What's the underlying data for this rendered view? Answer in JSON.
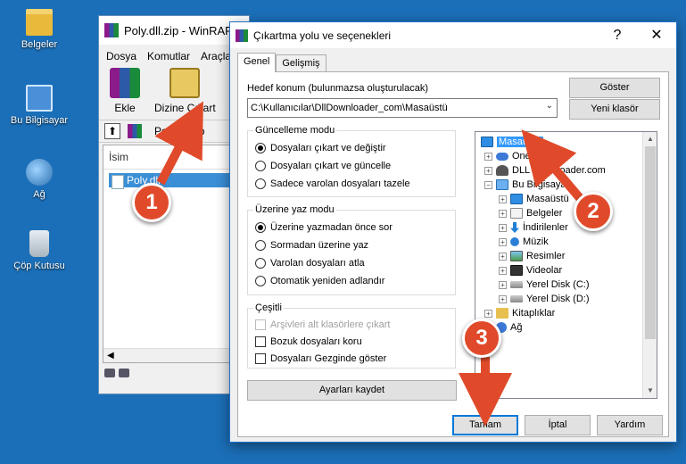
{
  "desktop": {
    "icons": [
      {
        "label": "Belgeler",
        "icon": "folder-icon"
      },
      {
        "label": "Bu Bilgisayar",
        "icon": "computer-icon"
      },
      {
        "label": "Ağ",
        "icon": "network-icon"
      },
      {
        "label": "Çöp Kutusu",
        "icon": "recycle-bin-icon"
      }
    ]
  },
  "winrar": {
    "title": "Poly.dll.zip - WinRAR",
    "menu": [
      "Dosya",
      "Komutlar",
      "Araçlar"
    ],
    "toolbar": {
      "add_label": "Ekle",
      "extract_label": "Dizine Çıkart"
    },
    "path": "Poly.dll.zip",
    "column_name": "İsim",
    "selected_file": "Poly.dll"
  },
  "dialog": {
    "title": "Çıkartma yolu ve seçenekleri",
    "help_glyph": "?",
    "close_glyph": "✕",
    "tabs": [
      "Genel",
      "Gelişmiş"
    ],
    "destination_label": "Hedef konum (bulunmazsa oluşturulacak)",
    "destination_value": "C:\\Kullanıcılar\\DllDownloader_com\\Masaüstü",
    "show_button": "Göster",
    "new_folder_button": "Yeni klasör",
    "update_mode": {
      "title": "Güncelleme modu",
      "options": [
        "Dosyaları çıkart ve değiştir",
        "Dosyaları çıkart ve güncelle",
        "Sadece varolan dosyaları tazele"
      ],
      "selected": 0
    },
    "overwrite_mode": {
      "title": "Üzerine yaz modu",
      "options": [
        "Üzerine yazmadan önce sor",
        "Sormadan üzerine yaz",
        "Varolan dosyaları atla",
        "Otomatik yeniden adlandır"
      ],
      "selected": 0
    },
    "misc": {
      "title": "Çeşitli",
      "options": [
        "Arşivleri alt klasörlere çıkart",
        "Bozuk dosyaları koru",
        "Dosyaları Gezginde göster"
      ]
    },
    "save_settings_button": "Ayarları kaydet",
    "tree": [
      {
        "label": "Masaüstü",
        "icon": "desktop",
        "level": 0,
        "selected": true
      },
      {
        "label": "OneDrive",
        "icon": "cloud",
        "level": 1
      },
      {
        "label": "DLL Downloader.com",
        "icon": "user",
        "level": 1
      },
      {
        "label": "Bu Bilgisayar",
        "icon": "pc",
        "level": 1,
        "expanded": true
      },
      {
        "label": "Masaüstü",
        "icon": "desktop",
        "level": 2
      },
      {
        "label": "Belgeler",
        "icon": "doc",
        "level": 2
      },
      {
        "label": "İndirilenler",
        "icon": "down",
        "level": 2
      },
      {
        "label": "Müzik",
        "icon": "music",
        "level": 2
      },
      {
        "label": "Resimler",
        "icon": "pic",
        "level": 2
      },
      {
        "label": "Videolar",
        "icon": "vid",
        "level": 2
      },
      {
        "label": "Yerel Disk (C:)",
        "icon": "disk",
        "level": 2
      },
      {
        "label": "Yerel Disk (D:)",
        "icon": "disk",
        "level": 2
      },
      {
        "label": "Kitaplıklar",
        "icon": "lib",
        "level": 1
      },
      {
        "label": "Ağ",
        "icon": "net",
        "level": 1
      }
    ],
    "ok_button": "Tamam",
    "cancel_button": "İptal",
    "help_button": "Yardım"
  },
  "annotations": [
    "1",
    "2",
    "3"
  ],
  "colors": {
    "badge": "#e04a2a",
    "selection": "#3399ff",
    "desktop_bg": "#1b6fb8"
  }
}
